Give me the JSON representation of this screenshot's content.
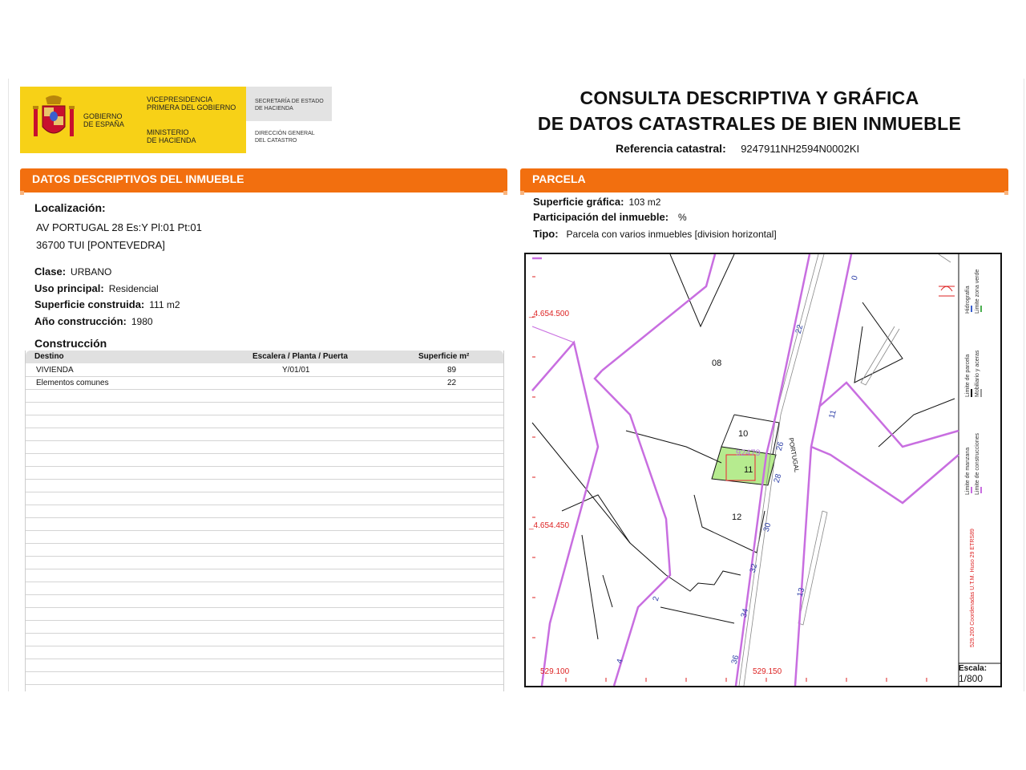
{
  "header": {
    "logo": {
      "gobierno": "GOBIERNO\nDE ESPAÑA",
      "vicepresidencia": "VICEPRESIDENCIA\nPRIMERA DEL GOBIERNO",
      "ministerio": "MINISTERIO\nDE HACIENDA",
      "secretaria": "SECRETARÍA DE ESTADO\nDE HACIENDA",
      "direccion": "DIRECCIÓN GENERAL\nDEL CATASTRO"
    },
    "title_line1": "CONSULTA DESCRIPTIVA Y GRÁFICA",
    "title_line2": "DE DATOS CATASTRALES DE BIEN INMUEBLE",
    "ref_label": "Referencia catastral:",
    "ref_value": "9247911NH2594N0002KI"
  },
  "left": {
    "section_title_prefix": "DATOS DESCRIPTIVOS DEL ",
    "section_title_strong": "INMUEBLE",
    "localizacion_label": "Localización:",
    "address_line1": "AV PORTUGAL 28 Es:Y Pl:01 Pt:01",
    "address_line2": "36700 TUI [PONTEVEDRA]",
    "clase_label": "Clase:",
    "clase_value": "URBANO",
    "uso_label": "Uso principal:",
    "uso_value": "Residencial",
    "superficie_label": "Superficie construida:",
    "superficie_value": "111 m2",
    "anio_label": "Año construcción:",
    "anio_value": "1980",
    "construccion_label": "Construcción",
    "table": {
      "headers": [
        "Destino",
        "Escalera / Planta / Puerta",
        "Superficie m²"
      ],
      "rows": [
        [
          "VIVIENDA",
          "Y/01/01",
          "89"
        ],
        [
          "Elementos comunes",
          "",
          "22"
        ]
      ]
    }
  },
  "right": {
    "section_title": "PARCELA",
    "superficie_label": "Superficie gráfica:",
    "superficie_value": "103 m2",
    "participacion_label": "Participación del inmueble:",
    "participacion_value": "%",
    "tipo_label": "Tipo:",
    "tipo_value": "Parcela con varios inmuebles [division horizontal]"
  },
  "map": {
    "coords": {
      "y_top": "_4.654.500",
      "y_bottom": "_4.654.450",
      "x_left": "529.100",
      "x_right": "529.150"
    },
    "parcel_labels": [
      "08",
      "10",
      "11",
      "12"
    ],
    "highlight_label": "92479",
    "street_name": "PORTUGAL",
    "house_numbers": [
      "0",
      "22",
      "11",
      "26",
      "28",
      "30",
      "32",
      "34",
      "36",
      "13",
      "2",
      "4"
    ],
    "legend": {
      "col1a": "Limite de manzana",
      "col1b": "Limite de parcela",
      "col1c": "Hidrografía",
      "col2a": "Limite de construcciones",
      "col2b": "Mobiliario y aceras",
      "col2c": "Limite zona verde",
      "coords_note": "529.200 Coordenadas U.T.M. Huso 29 ETRS89"
    },
    "scale_label": "Escala:",
    "scale_value": "1/800",
    "colors": {
      "block": "#c86ee0",
      "parcel": "#111111",
      "highlight": "#b6eb8f",
      "coord": "#dd2222",
      "numbers": "#2d3fa8"
    }
  }
}
